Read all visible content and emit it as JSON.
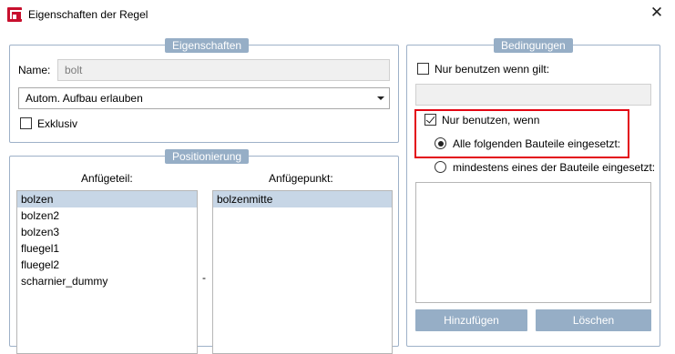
{
  "window": {
    "title": "Eigenschaften der Regel",
    "close_glyph": "✕"
  },
  "eigenschaften": {
    "legend": "Eigenschaften",
    "name_label": "Name:",
    "name_value": "bolt",
    "combo_value": "Autom. Aufbau erlauben",
    "exklusiv_label": "Exklusiv",
    "exklusiv_checked": false
  },
  "positionierung": {
    "legend": "Positionierung",
    "anfuegeteil_header": "Anfügeteil:",
    "anfuegepunkt_header": "Anfügepunkt:",
    "separator": "-",
    "anfuegeteil_items": [
      "bolzen",
      "bolzen2",
      "bolzen3",
      "fluegel1",
      "fluegel2",
      "scharnier_dummy"
    ],
    "anfuegeteil_selected": "bolzen",
    "anfuegepunkt_items": [
      "bolzenmitte"
    ],
    "anfuegepunkt_selected": "bolzenmitte"
  },
  "bedingungen": {
    "legend": "Bedingungen",
    "nur_wenn_gilt_label": "Nur benutzen wenn gilt:",
    "nur_wenn_gilt_checked": false,
    "condition_value": "",
    "nur_wenn_label": "Nur benutzen, wenn",
    "nur_wenn_checked": true,
    "alle_label": "Alle folgenden Bauteile eingesetzt:",
    "alle_selected": true,
    "mindestens_label": "mindestens eines der Bauteile eingesetzt:",
    "mindestens_selected": false,
    "add_button": "Hinzufügen",
    "delete_button": "Löschen"
  },
  "colors": {
    "accent": "#96aec6",
    "highlight": "#e30613",
    "selection": "#c7d6e6"
  }
}
